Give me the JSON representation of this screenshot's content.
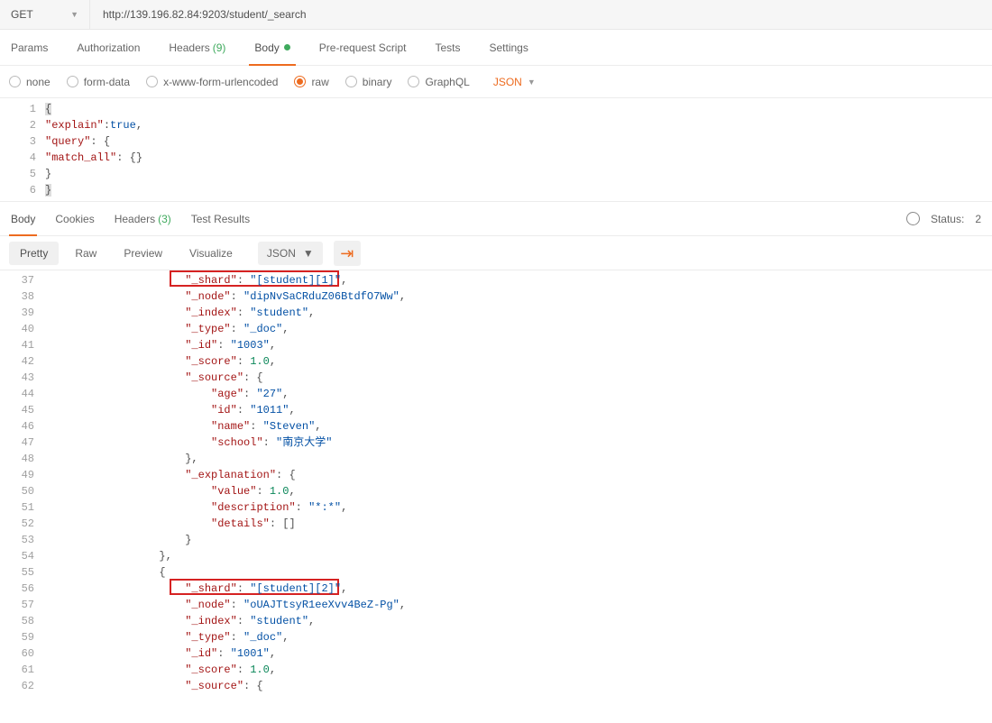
{
  "url_bar": {
    "method": "GET",
    "url": "http://139.196.82.84:9203/student/_search"
  },
  "req_tabs": {
    "params": "Params",
    "authorization": "Authorization",
    "headers": "Headers",
    "headers_count": "(9)",
    "body": "Body",
    "prerequest": "Pre-request Script",
    "tests": "Tests",
    "settings": "Settings"
  },
  "body_types": {
    "none": "none",
    "formdata": "form-data",
    "xwww": "x-www-form-urlencoded",
    "raw": "raw",
    "binary": "binary",
    "graphql": "GraphQL",
    "json": "JSON"
  },
  "request_body": {
    "l1": "{",
    "l2_pre": "  ",
    "l2_k": "\"explain\"",
    "l2_mid": ":",
    "l2_v": "true",
    "l2_post": ",",
    "l3_pre": "  ",
    "l3_k": "\"query\"",
    "l3_post": ": {",
    "l4_pre": "    ",
    "l4_k": "\"match_all\"",
    "l4_post": ": {}",
    "l5": "  }",
    "l6": "}"
  },
  "req_lines": [
    "1",
    "2",
    "3",
    "4",
    "5",
    "6"
  ],
  "resp_tabs": {
    "body": "Body",
    "cookies": "Cookies",
    "headers": "Headers",
    "headers_count": "(3)",
    "test_results": "Test Results"
  },
  "status": {
    "label": "Status:",
    "code": "2"
  },
  "view_row": {
    "pretty": "Pretty",
    "raw": "Raw",
    "preview": "Preview",
    "visualize": "Visualize",
    "json": "JSON"
  },
  "resp_lines": [
    "37",
    "38",
    "39",
    "40",
    "41",
    "42",
    "43",
    "44",
    "45",
    "46",
    "47",
    "48",
    "49",
    "50",
    "51",
    "52",
    "53",
    "54",
    "55",
    "56",
    "57",
    "58",
    "59",
    "60",
    "61",
    "62"
  ],
  "resp": {
    "indent4": "                ",
    "indent5": "                    ",
    "indent3": "            ",
    "shard_k": "\"_shard\"",
    "shard_v1": "\"[student][1]\"",
    "shard_v2": "\"[student][2]\"",
    "node_k": "\"_node\"",
    "node_v1": "\"dipNvSaCRduZ06BtdfO7Ww\"",
    "node_v2": "\"oUAJTtsyR1eeXvv4BeZ-Pg\"",
    "index_k": "\"_index\"",
    "index_v": "\"student\"",
    "type_k": "\"_type\"",
    "type_v": "\"_doc\"",
    "id_k": "\"_id\"",
    "id_v1": "\"1003\"",
    "id_v2": "\"1001\"",
    "score_k": "\"_score\"",
    "score_v": "1.0",
    "source_k": "\"_source\"",
    "age_k": "\"age\"",
    "age_v": "\"27\"",
    "sid_k": "\"id\"",
    "sid_v": "\"1011\"",
    "name_k": "\"name\"",
    "name_v": "\"Steven\"",
    "school_k": "\"school\"",
    "school_v": "\"南京大学\"",
    "expl_k": "\"_explanation\"",
    "value_k": "\"value\"",
    "value_v": "1.0",
    "desc_k": "\"description\"",
    "desc_v": "\"*:*\"",
    "details_k": "\"details\"",
    "details_v": "[]",
    "close_brace": "}",
    "close_brace_c": "},",
    "open_brace": "{",
    "colon_open": ": {",
    "colon_sp": ": ",
    "comma": ","
  }
}
